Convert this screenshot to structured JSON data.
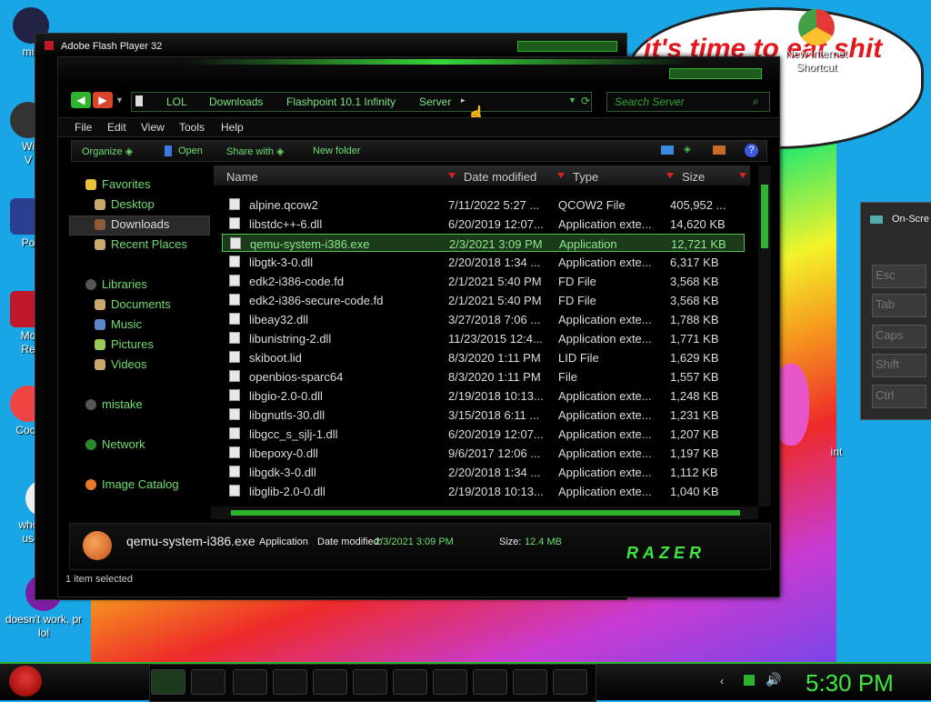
{
  "desktop": {
    "icons": [
      {
        "label": "mis"
      },
      {
        "label": "Wi\nV"
      },
      {
        "label": "Po"
      },
      {
        "label": "Mo\nRe"
      },
      {
        "label": "Cock"
      },
      {
        "label": "who the fu\nuses this"
      },
      {
        "label": "doesn't work, pr\nlol"
      },
      {
        "label": "New Internet\nShortcut"
      },
      {
        "label": "int"
      }
    ],
    "bubble_text": "it's time to eat shit\nnew"
  },
  "back_window": {
    "title": "Adobe Flash Player 32"
  },
  "osk": {
    "title": "On-Scre",
    "keys": [
      "Esc",
      "Tab",
      "Caps",
      "Shift",
      "Ctrl"
    ]
  },
  "explorer": {
    "breadcrumbs": [
      "LOL",
      "Downloads",
      "Flashpoint 10.1 Infinity",
      "Server"
    ],
    "search_placeholder": "Search Server",
    "menu": [
      "File",
      "Edit",
      "View",
      "Tools",
      "Help"
    ],
    "commands": [
      "Organize",
      "Open",
      "Share with",
      "New folder"
    ],
    "nav": {
      "favorites": "Favorites",
      "fav_items": [
        "Desktop",
        "Downloads",
        "Recent Places"
      ],
      "libraries": "Libraries",
      "lib_items": [
        "Documents",
        "Music",
        "Pictures",
        "Videos"
      ],
      "mistake": "mistake",
      "network": "Network",
      "image_catalog": "Image Catalog"
    },
    "columns": [
      "Name",
      "Date modified",
      "Type",
      "Size"
    ],
    "files": [
      {
        "name": "alpine.qcow2",
        "date": "7/11/2022 5:27 ...",
        "type": "QCOW2 File",
        "size": "405,952 ..."
      },
      {
        "name": "libstdc++-6.dll",
        "date": "6/20/2019 12:07...",
        "type": "Application exte...",
        "size": "14,620 KB"
      },
      {
        "name": "qemu-system-i386.exe",
        "date": "2/3/2021 3:09 PM",
        "type": "Application",
        "size": "12,721 KB"
      },
      {
        "name": "libgtk-3-0.dll",
        "date": "2/20/2018 1:34 ...",
        "type": "Application exte...",
        "size": "6,317 KB"
      },
      {
        "name": "edk2-i386-code.fd",
        "date": "2/1/2021 5:40 PM",
        "type": "FD File",
        "size": "3,568 KB"
      },
      {
        "name": "edk2-i386-secure-code.fd",
        "date": "2/1/2021 5:40 PM",
        "type": "FD File",
        "size": "3,568 KB"
      },
      {
        "name": "libeay32.dll",
        "date": "3/27/2018 7:06 ...",
        "type": "Application exte...",
        "size": "1,788 KB"
      },
      {
        "name": "libunistring-2.dll",
        "date": "11/23/2015 12:4...",
        "type": "Application exte...",
        "size": "1,771 KB"
      },
      {
        "name": "skiboot.lid",
        "date": "8/3/2020 1:11 PM",
        "type": "LID File",
        "size": "1,629 KB"
      },
      {
        "name": "openbios-sparc64",
        "date": "8/3/2020 1:11 PM",
        "type": "File",
        "size": "1,557 KB"
      },
      {
        "name": "libgio-2.0-0.dll",
        "date": "2/19/2018 10:13...",
        "type": "Application exte...",
        "size": "1,248 KB"
      },
      {
        "name": "libgnutls-30.dll",
        "date": "3/15/2018 6:11 ...",
        "type": "Application exte...",
        "size": "1,231 KB"
      },
      {
        "name": "libgcc_s_sjlj-1.dll",
        "date": "6/20/2019 12:07...",
        "type": "Application exte...",
        "size": "1,207 KB"
      },
      {
        "name": "libepoxy-0.dll",
        "date": "9/6/2017 12:06 ...",
        "type": "Application exte...",
        "size": "1,197 KB"
      },
      {
        "name": "libgdk-3-0.dll",
        "date": "2/20/2018 1:34 ...",
        "type": "Application exte...",
        "size": "1,112 KB"
      },
      {
        "name": "libglib-2.0-0.dll",
        "date": "2/19/2018 10:13...",
        "type": "Application exte...",
        "size": "1,040 KB"
      }
    ],
    "details": {
      "filename": "qemu-system-i386.exe",
      "type": "Application",
      "date_label": "Date modified:",
      "date_value": "2/3/2021 3:09 PM",
      "size_label": "Size:",
      "size_value": "12.4 MB",
      "brand": "RAZER"
    },
    "status": "1 item selected"
  },
  "taskbar": {
    "clock": "5:30 PM"
  },
  "colors": {
    "accent": "#2fb32f",
    "text_green": "#6fde6f",
    "clock": "#3ee83e"
  }
}
